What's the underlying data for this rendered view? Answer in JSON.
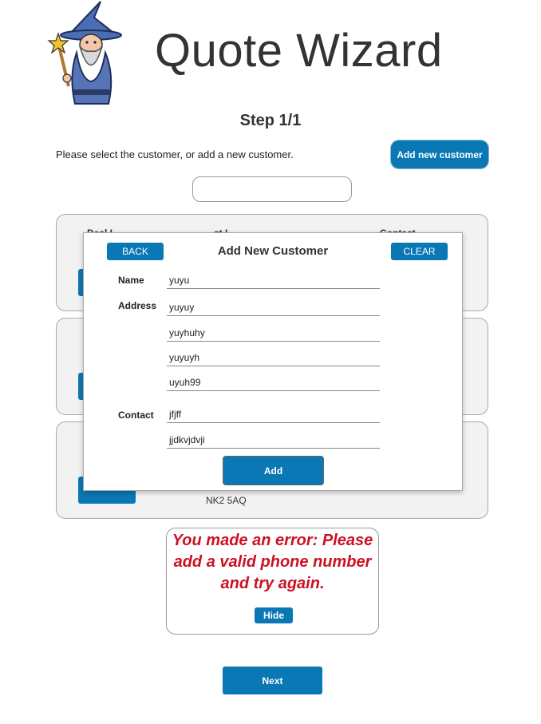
{
  "header": {
    "title": "Quote Wizard",
    "step": "Step 1/1",
    "instruction": "Please select the customer, or add a new customer.",
    "add_new_customer_label": "Add new customer"
  },
  "search": {
    "value": "",
    "placeholder": ""
  },
  "customers_list": {
    "column_header_partial": [
      "Deal I…",
      "…st  I…",
      "Contact"
    ],
    "third_card_postcode": "NK2 5AQ"
  },
  "modal": {
    "title": "Add New Customer",
    "back_label": "BACK",
    "clear_label": "CLEAR",
    "name_label": "Name",
    "name_value": "yuyu",
    "address_label": "Address",
    "address_lines": [
      "yuyuy",
      "yuyhuhy",
      "yuyuyh",
      "uyuh99"
    ],
    "contact_label": "Contact",
    "contact_lines": [
      "jfjff",
      "jjdkvjdvji"
    ],
    "add_label": "Add"
  },
  "error": {
    "message": "You made an error: Please add a valid phone number and try again.",
    "hide_label": "Hide"
  },
  "footer": {
    "next_label": "Next"
  },
  "colors": {
    "accent": "#0a78b4",
    "error": "#cc1122"
  }
}
